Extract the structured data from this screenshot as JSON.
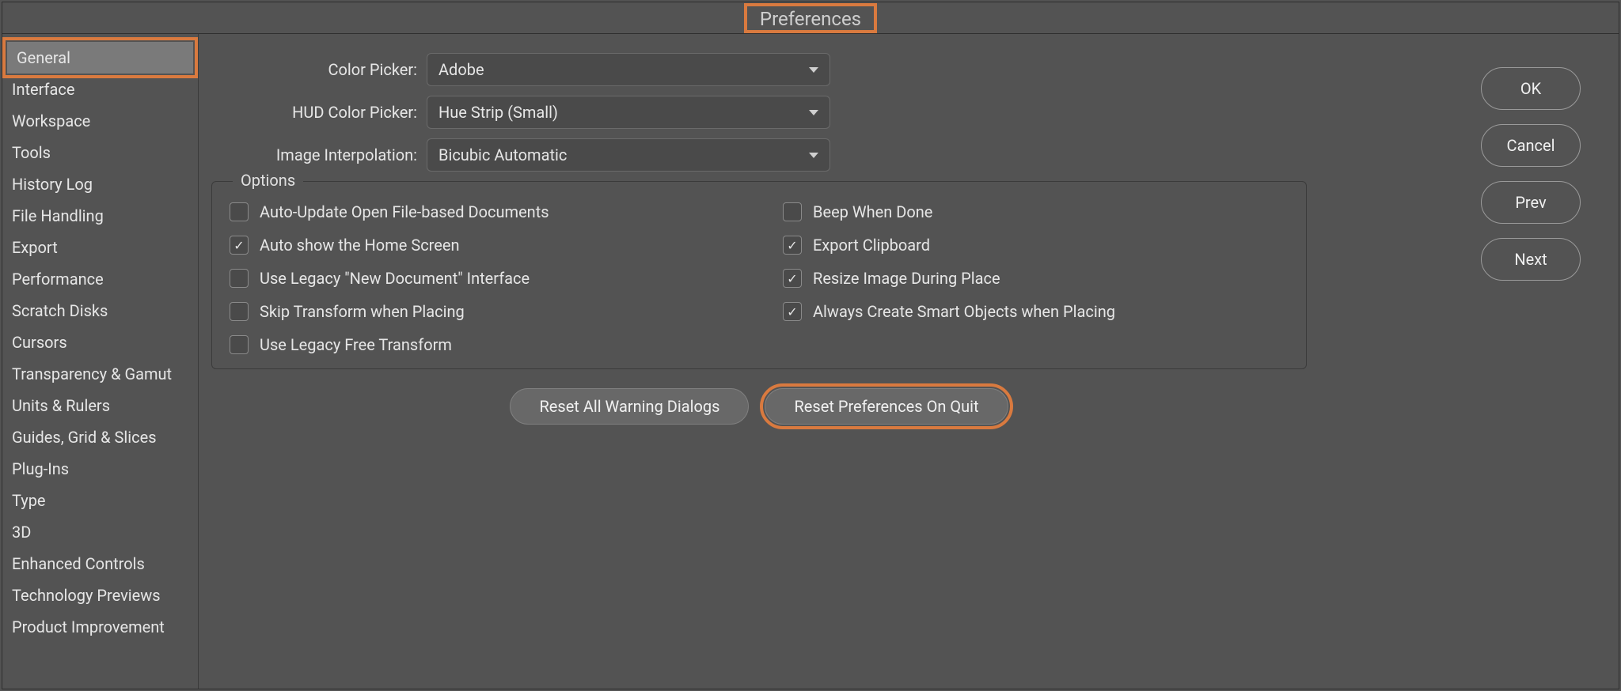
{
  "title": "Preferences",
  "sidebar": {
    "items": [
      {
        "label": "General",
        "selected": true
      },
      {
        "label": "Interface"
      },
      {
        "label": "Workspace"
      },
      {
        "label": "Tools"
      },
      {
        "label": "History Log"
      },
      {
        "label": "File Handling"
      },
      {
        "label": "Export"
      },
      {
        "label": "Performance"
      },
      {
        "label": "Scratch Disks"
      },
      {
        "label": "Cursors"
      },
      {
        "label": "Transparency & Gamut"
      },
      {
        "label": "Units & Rulers"
      },
      {
        "label": "Guides, Grid & Slices"
      },
      {
        "label": "Plug-Ins"
      },
      {
        "label": "Type"
      },
      {
        "label": "3D"
      },
      {
        "label": "Enhanced Controls"
      },
      {
        "label": "Technology Previews"
      },
      {
        "label": "Product Improvement"
      }
    ]
  },
  "labels": {
    "color_picker": "Color Picker:",
    "hud_color_picker": "HUD Color Picker:",
    "image_interpolation": "Image Interpolation:",
    "options_legend": "Options"
  },
  "selects": {
    "color_picker": "Adobe",
    "hud_color_picker": "Hue Strip (Small)",
    "image_interpolation": "Bicubic Automatic"
  },
  "options": {
    "left": [
      {
        "label": "Auto-Update Open File-based Documents",
        "checked": false
      },
      {
        "label": "Auto show the Home Screen",
        "checked": true
      },
      {
        "label": "Use Legacy \"New Document\" Interface",
        "checked": false
      },
      {
        "label": "Skip Transform when Placing",
        "checked": false
      },
      {
        "label": "Use Legacy Free Transform",
        "checked": false
      }
    ],
    "right": [
      {
        "label": "Beep When Done",
        "checked": false
      },
      {
        "label": "Export Clipboard",
        "checked": true
      },
      {
        "label": "Resize Image During Place",
        "checked": true
      },
      {
        "label": "Always Create Smart Objects when Placing",
        "checked": true
      }
    ]
  },
  "buttons": {
    "reset_warnings": "Reset All Warning Dialogs",
    "reset_on_quit": "Reset Preferences On Quit",
    "ok": "OK",
    "cancel": "Cancel",
    "prev": "Prev",
    "next": "Next"
  },
  "highlight": {
    "title": true,
    "sidebar_general": true,
    "reset_on_quit": true
  }
}
